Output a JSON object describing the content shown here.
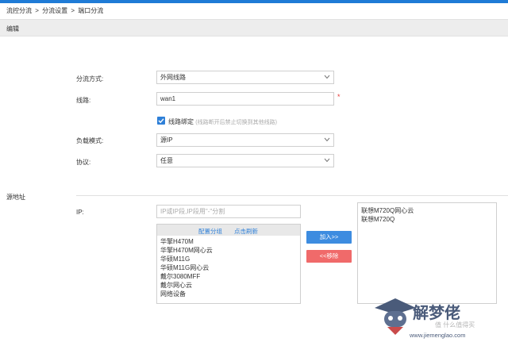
{
  "breadcrumb": {
    "item1": "流控分流",
    "sep": ">",
    "item2": "分流设置",
    "item3": "端口分流"
  },
  "section": {
    "title": "编辑"
  },
  "form": {
    "mode_label": "分流方式:",
    "mode_value": "外网线路",
    "line_label": "线路:",
    "line_value": "wan1",
    "required_mark": "*",
    "bind_label": "线路绑定",
    "bind_hint": "(线路断开后禁止切换到其他线路)",
    "bind_checked": true,
    "balance_label": "负载模式:",
    "balance_value": "源IP",
    "protocol_label": "协议:",
    "protocol_value": "任意"
  },
  "source": {
    "title": "源地址",
    "ip_label": "IP:",
    "ip_placeholder": "IP或IP段,IP段用\"-\"分割",
    "config_group": "配置分组",
    "refresh": "点击刷新",
    "available": [
      "华擎H470M",
      "华擎H470M网心云",
      "华硕M11G",
      "华硕M11G网心云",
      "戴尔3080MFF",
      "戴尔网心云",
      "网络设备"
    ],
    "add_button": "加入>>",
    "remove_button": "<<移除",
    "selected": [
      "联想M720Q网心云",
      "联想M720Q"
    ]
  },
  "watermark": {
    "brand": "解梦佬",
    "url": "www.jiemenglao.com",
    "overlay": "值 什么值得买"
  },
  "colors": {
    "accent": "#1f7bd6",
    "checkbox": "#2f80d8",
    "add": "#3d8ce0",
    "remove": "#f06a6a",
    "required": "#e53935"
  }
}
